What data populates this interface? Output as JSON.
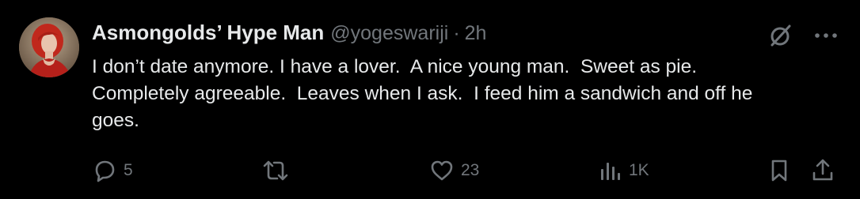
{
  "tweet": {
    "display_name": "Asmongolds’ Hype Man",
    "handle": "@yogeswariji",
    "separator": "·",
    "time": "2h",
    "text": "I don’t date anymore. I have a lover.  A nice young man.  Sweet as pie.\nCompletely agreeable.  Leaves when I ask.  I feed him a sandwich and off he\ngoes."
  },
  "actions": {
    "replies": "5",
    "retweets": "",
    "likes": "23",
    "views": "1K"
  },
  "icons": {
    "top": [
      "grok-icon",
      "more-icon"
    ],
    "bottom": [
      "reply-icon",
      "retweet-icon",
      "like-icon",
      "views-icon",
      "bookmark-icon",
      "share-icon"
    ]
  },
  "colors": {
    "background": "#000000",
    "primary_text": "#e7e9ea",
    "secondary_text": "#71767b"
  }
}
